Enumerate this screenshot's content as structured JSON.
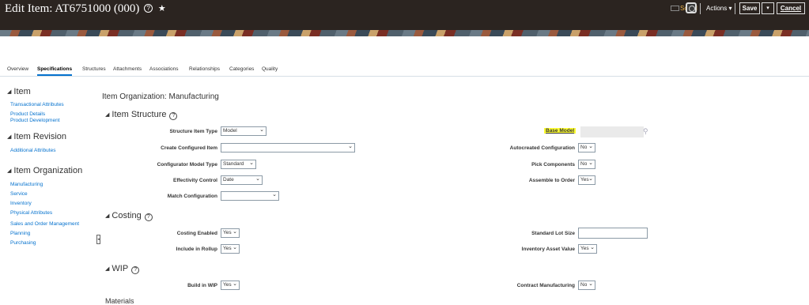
{
  "header": {
    "title": "Edit Item: AT6751000 (000)",
    "help_glyph": "?",
    "star_glyph": "★",
    "social_label": "Social",
    "actions_label": "Actions ▾",
    "save_label": "Save",
    "save_menu_glyph": "▾",
    "cancel_label": "Cancel"
  },
  "tabs": [
    "Overview",
    "Specifications",
    "Structures",
    "Attachments",
    "Associations",
    "Relationships",
    "Categories",
    "Quality"
  ],
  "nav": {
    "item_header": "Item",
    "item_links": [
      "Transactional Attributes",
      "Product Details",
      "Product Development"
    ],
    "revision_header": "Item Revision",
    "revision_links": [
      "Additional Attributes"
    ],
    "org_header": "Item Organization",
    "org_links": [
      "Manufacturing",
      "Service",
      "Inventory",
      "Physical Attributes",
      "Sales and Order Management",
      "Planning",
      "Purchasing"
    ]
  },
  "main": {
    "org_title": "Item Organization: Manufacturing",
    "sections": {
      "item_structure": "Item Structure",
      "costing": "Costing",
      "wip": "WIP",
      "materials": "Materials"
    },
    "fields": {
      "structure_item_type": {
        "label": "Structure Item Type",
        "value": "Model"
      },
      "create_configured_item": {
        "label": "Create Configured Item",
        "value": ""
      },
      "configurator_model_type": {
        "label": "Configurator Model Type",
        "value": "Standard"
      },
      "effectivity_control": {
        "label": "Effectivity Control",
        "value": "Date"
      },
      "match_configuration": {
        "label": "Match Configuration",
        "value": ""
      },
      "base_model": {
        "label": "Base Model",
        "value": ""
      },
      "autocreated_configuration": {
        "label": "Autocreated Configuration",
        "value": "No"
      },
      "pick_components": {
        "label": "Pick Components",
        "value": "No"
      },
      "assemble_to_order": {
        "label": "Assemble to Order",
        "value": "Yes"
      },
      "costing_enabled": {
        "label": "Costing Enabled",
        "value": "Yes"
      },
      "include_in_rollup": {
        "label": "Include in Rollup",
        "value": "Yes"
      },
      "standard_lot_size": {
        "label": "Standard Lot Size",
        "value": ""
      },
      "inventory_asset_value": {
        "label": "Inventory Asset Value",
        "value": "Yes"
      },
      "build_in_wip": {
        "label": "Build in WIP",
        "value": "Yes"
      },
      "contract_manufacturing": {
        "label": "Contract Manufacturing",
        "value": "No"
      }
    }
  },
  "colors": {
    "header_bg": "#2b2420",
    "link": "#0572ce",
    "highlight": "#ffff33"
  }
}
